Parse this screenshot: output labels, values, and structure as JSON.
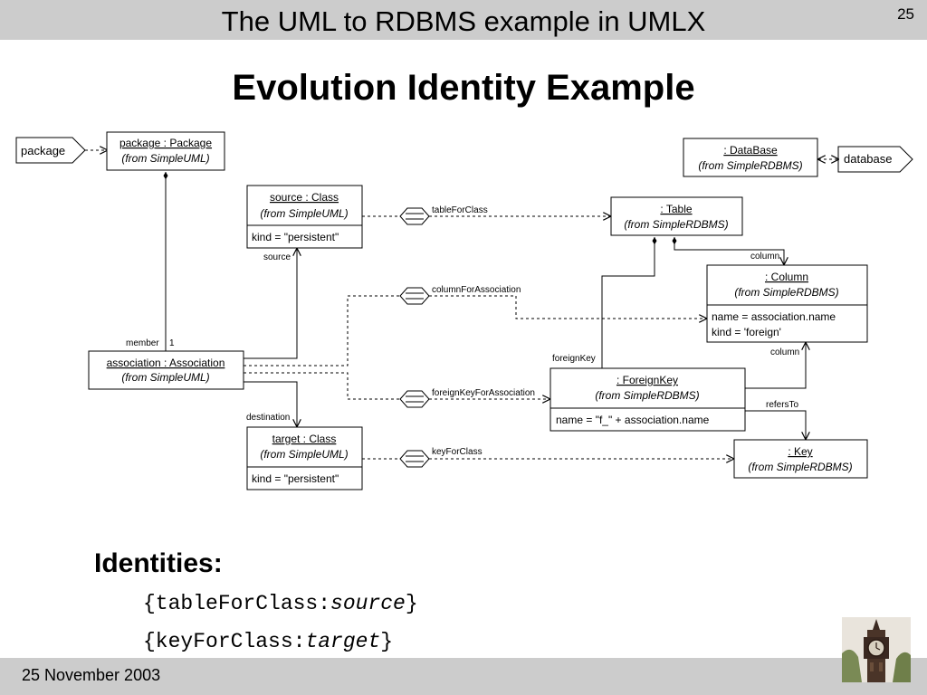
{
  "header": {
    "title": "The UML to RDBMS example in UMLX",
    "page_number": "25"
  },
  "slide": {
    "title": "Evolution Identity Example"
  },
  "diagram": {
    "ports": {
      "package": "package",
      "database": "database"
    },
    "classes": {
      "package": {
        "name": "package : Package",
        "from": "(from SimpleUML)"
      },
      "source": {
        "name": "source : Class",
        "from": "(from SimpleUML)",
        "attr": "kind = \"persistent\""
      },
      "association": {
        "name": "association : Association",
        "from": "(from SimpleUML)"
      },
      "target": {
        "name": "target : Class",
        "from": "(from SimpleUML)",
        "attr": "kind = \"persistent\""
      },
      "database": {
        "name": ": DataBase",
        "from": "(from SimpleRDBMS)"
      },
      "table": {
        "name": ": Table",
        "from": "(from SimpleRDBMS)"
      },
      "column": {
        "name": ": Column",
        "from": "(from SimpleRDBMS)",
        "attr1": "name = association.name",
        "attr2": "kind = 'foreign'"
      },
      "foreignkey": {
        "name": ": ForeignKey",
        "from": "(from SimpleRDBMS)",
        "attr": "name = \"f_\" + association.name"
      },
      "key": {
        "name": ": Key",
        "from": "(from SimpleRDBMS)"
      }
    },
    "roles": {
      "source": "source",
      "member": "member",
      "one": "1",
      "destination": "destination",
      "column_top": "column",
      "column_mid": "column",
      "foreignKey": "foreignKey",
      "refersTo": "refersTo"
    },
    "transforms": {
      "tableForClass": "tableForClass",
      "columnForAssociation": "columnForAssociation",
      "foreignKeyForAssociation": "foreignKeyForAssociation",
      "keyForClass": "keyForClass"
    }
  },
  "identities": {
    "heading": "Identities:",
    "items": [
      {
        "prefix": "{tableForClass:",
        "role": "source",
        "suffix": "}"
      },
      {
        "prefix": "{keyForClass:",
        "role": "target",
        "suffix": "}"
      }
    ]
  },
  "footer": {
    "date": "25 November 2003"
  },
  "logo": {
    "icon": "clock-tower-icon"
  }
}
